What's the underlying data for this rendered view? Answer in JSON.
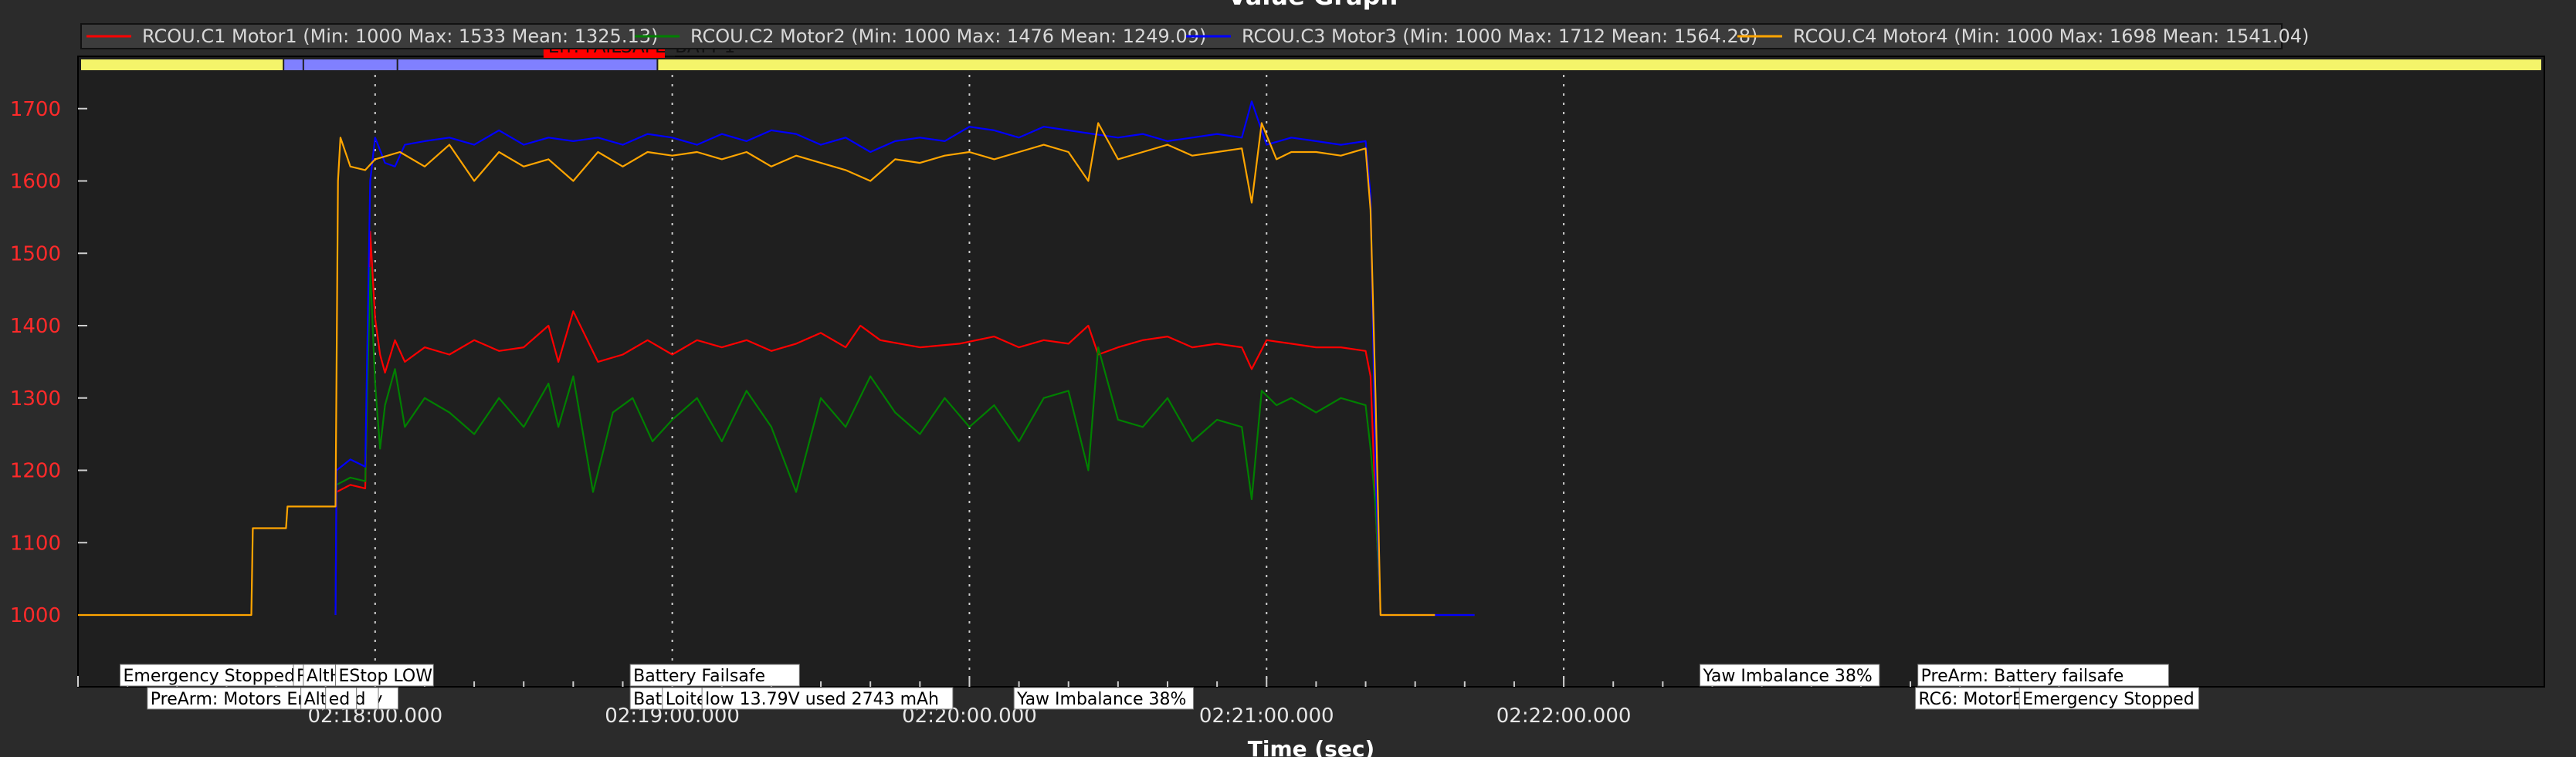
{
  "window": {
    "title": "Value Graph"
  },
  "legend": [
    {
      "label": "RCOU.C1 Motor1 (Min: 1000 Max: 1533 Mean: 1325.13)",
      "color": "#ff0000"
    },
    {
      "label": "RCOU.C2 Motor2 (Min: 1000 Max: 1476 Mean: 1249.09)",
      "color": "#008000"
    },
    {
      "label": "RCOU.C3 Motor3 (Min: 1000 Max: 1712 Mean: 1564.28)",
      "color": "#0000ff"
    },
    {
      "label": "RCOU.C4 Motor4 (Min: 1000 Max: 1698 Mean: 1541.04)",
      "color": "#ffa500"
    }
  ],
  "mode_bar": {
    "error_label": "Err: FAILSAFE_BATT-1"
  },
  "events_row1": [
    {
      "text": "Emergency Stopped",
      "t": 8.5
    },
    {
      "text": "RC",
      "t": 43.5
    },
    {
      "text": "AltHold",
      "t": 45.5
    },
    {
      "text": "EStop LOW",
      "t": 52
    },
    {
      "text": "Battery Failsafe",
      "t": 111.5
    },
    {
      "text": "Yaw Imbalance 38%",
      "t": 327.5
    },
    {
      "text": "PreArm: Battery failsafe",
      "t": 371.5
    }
  ],
  "events_row2": [
    {
      "text": "PreArm: Motors Emergency",
      "t": 14
    },
    {
      "text": "AltHold",
      "t": 45
    },
    {
      "text": "ed",
      "t": 50
    },
    {
      "text": "Batte",
      "t": 111.5
    },
    {
      "text": "Loiter",
      "t": 118
    },
    {
      "text": "low 13.79V used 2743 mAh",
      "t": 126
    },
    {
      "text": "Yaw Imbalance 38%",
      "t": 189
    },
    {
      "text": "RC6: MotorEStop HIGH",
      "t": 371
    },
    {
      "text": "Emergency Stopped",
      "t": 392
    }
  ],
  "chart_data": {
    "type": "line",
    "xlabel": "Time (sec)",
    "ylabel": "",
    "x_unit": "clock time",
    "xlim_seconds_from_02_17_00": [
      0,
      400
    ],
    "ylim": [
      940,
      1740
    ],
    "yticks": [
      1000,
      1100,
      1200,
      1300,
      1400,
      1500,
      1600,
      1700
    ],
    "xticks": [
      {
        "t": 60,
        "label": "02:18:00.000"
      },
      {
        "t": 120,
        "label": "02:19:00.000"
      },
      {
        "t": 180,
        "label": "02:20:00.000"
      },
      {
        "t": 240,
        "label": "02:21:00.000"
      },
      {
        "t": 300,
        "label": "02:22:00.000"
      }
    ],
    "grid": true,
    "series": [
      {
        "name": "RCOU.C1 Motor1",
        "color": "#ff0000",
        "points": [
          [
            52,
            1000
          ],
          [
            52.2,
            1170
          ],
          [
            55,
            1180
          ],
          [
            58,
            1175
          ],
          [
            59,
            1530
          ],
          [
            60,
            1410
          ],
          [
            61,
            1360
          ],
          [
            62,
            1335
          ],
          [
            64,
            1380
          ],
          [
            66,
            1350
          ],
          [
            70,
            1370
          ],
          [
            75,
            1360
          ],
          [
            80,
            1380
          ],
          [
            85,
            1365
          ],
          [
            90,
            1370
          ],
          [
            95,
            1400
          ],
          [
            97,
            1350
          ],
          [
            100,
            1420
          ],
          [
            105,
            1350
          ],
          [
            110,
            1360
          ],
          [
            115,
            1380
          ],
          [
            120,
            1360
          ],
          [
            125,
            1380
          ],
          [
            130,
            1370
          ],
          [
            135,
            1380
          ],
          [
            140,
            1365
          ],
          [
            145,
            1375
          ],
          [
            150,
            1390
          ],
          [
            155,
            1370
          ],
          [
            158,
            1400
          ],
          [
            162,
            1380
          ],
          [
            170,
            1370
          ],
          [
            178,
            1375
          ],
          [
            185,
            1385
          ],
          [
            190,
            1370
          ],
          [
            195,
            1380
          ],
          [
            200,
            1375
          ],
          [
            204,
            1400
          ],
          [
            206,
            1360
          ],
          [
            210,
            1370
          ],
          [
            215,
            1380
          ],
          [
            220,
            1385
          ],
          [
            225,
            1370
          ],
          [
            230,
            1375
          ],
          [
            235,
            1370
          ],
          [
            237,
            1340
          ],
          [
            240,
            1380
          ],
          [
            245,
            1375
          ],
          [
            250,
            1370
          ],
          [
            255,
            1370
          ],
          [
            260,
            1365
          ],
          [
            261,
            1330
          ],
          [
            262,
            1150
          ],
          [
            263,
            1000
          ],
          [
            282,
            1000
          ]
        ]
      },
      {
        "name": "RCOU.C2 Motor2",
        "color": "#008000",
        "points": [
          [
            52,
            1000
          ],
          [
            52.2,
            1180
          ],
          [
            55,
            1190
          ],
          [
            58,
            1185
          ],
          [
            59,
            1480
          ],
          [
            60,
            1320
          ],
          [
            61,
            1230
          ],
          [
            62,
            1290
          ],
          [
            64,
            1340
          ],
          [
            66,
            1260
          ],
          [
            70,
            1300
          ],
          [
            75,
            1280
          ],
          [
            80,
            1250
          ],
          [
            85,
            1300
          ],
          [
            90,
            1260
          ],
          [
            95,
            1320
          ],
          [
            97,
            1260
          ],
          [
            100,
            1330
          ],
          [
            104,
            1170
          ],
          [
            108,
            1280
          ],
          [
            112,
            1300
          ],
          [
            116,
            1240
          ],
          [
            120,
            1270
          ],
          [
            125,
            1300
          ],
          [
            130,
            1240
          ],
          [
            135,
            1310
          ],
          [
            140,
            1260
          ],
          [
            145,
            1170
          ],
          [
            150,
            1300
          ],
          [
            155,
            1260
          ],
          [
            160,
            1330
          ],
          [
            165,
            1280
          ],
          [
            170,
            1250
          ],
          [
            175,
            1300
          ],
          [
            180,
            1260
          ],
          [
            185,
            1290
          ],
          [
            190,
            1240
          ],
          [
            195,
            1300
          ],
          [
            200,
            1310
          ],
          [
            204,
            1200
          ],
          [
            206,
            1370
          ],
          [
            210,
            1270
          ],
          [
            215,
            1260
          ],
          [
            220,
            1300
          ],
          [
            225,
            1240
          ],
          [
            230,
            1270
          ],
          [
            235,
            1260
          ],
          [
            237,
            1160
          ],
          [
            239,
            1310
          ],
          [
            242,
            1290
          ],
          [
            245,
            1300
          ],
          [
            250,
            1280
          ],
          [
            255,
            1300
          ],
          [
            260,
            1290
          ],
          [
            261,
            1230
          ],
          [
            262,
            1150
          ],
          [
            263,
            1000
          ],
          [
            282,
            1000
          ]
        ]
      },
      {
        "name": "RCOU.C3 Motor3",
        "color": "#0000ff",
        "points": [
          [
            52,
            1000
          ],
          [
            52.2,
            1200
          ],
          [
            55,
            1215
          ],
          [
            58,
            1205
          ],
          [
            59,
            1600
          ],
          [
            60,
            1660
          ],
          [
            62,
            1625
          ],
          [
            64,
            1620
          ],
          [
            66,
            1650
          ],
          [
            70,
            1655
          ],
          [
            75,
            1660
          ],
          [
            80,
            1650
          ],
          [
            85,
            1670
          ],
          [
            90,
            1650
          ],
          [
            95,
            1660
          ],
          [
            100,
            1655
          ],
          [
            105,
            1660
          ],
          [
            110,
            1650
          ],
          [
            115,
            1665
          ],
          [
            120,
            1660
          ],
          [
            125,
            1650
          ],
          [
            130,
            1665
          ],
          [
            135,
            1655
          ],
          [
            140,
            1670
          ],
          [
            145,
            1665
          ],
          [
            150,
            1650
          ],
          [
            155,
            1660
          ],
          [
            160,
            1640
          ],
          [
            165,
            1655
          ],
          [
            170,
            1660
          ],
          [
            175,
            1655
          ],
          [
            180,
            1675
          ],
          [
            185,
            1670
          ],
          [
            190,
            1660
          ],
          [
            195,
            1675
          ],
          [
            200,
            1670
          ],
          [
            205,
            1665
          ],
          [
            210,
            1660
          ],
          [
            215,
            1665
          ],
          [
            220,
            1655
          ],
          [
            225,
            1660
          ],
          [
            230,
            1665
          ],
          [
            235,
            1660
          ],
          [
            237,
            1710
          ],
          [
            240,
            1650
          ],
          [
            245,
            1660
          ],
          [
            250,
            1655
          ],
          [
            255,
            1650
          ],
          [
            260,
            1655
          ],
          [
            261,
            1580
          ],
          [
            262,
            1200
          ],
          [
            263,
            1000
          ],
          [
            282,
            1000
          ]
        ]
      },
      {
        "name": "RCOU.C4 Motor4",
        "color": "#ffa500",
        "points": [
          [
            0,
            1000
          ],
          [
            35,
            1000
          ],
          [
            35.3,
            1120
          ],
          [
            42,
            1120
          ],
          [
            42.3,
            1150
          ],
          [
            49,
            1150
          ],
          [
            49.3,
            1150
          ],
          [
            52,
            1150
          ],
          [
            52.5,
            1600
          ],
          [
            53,
            1660
          ],
          [
            55,
            1620
          ],
          [
            58,
            1615
          ],
          [
            60,
            1630
          ],
          [
            65,
            1640
          ],
          [
            70,
            1620
          ],
          [
            75,
            1650
          ],
          [
            80,
            1600
          ],
          [
            85,
            1640
          ],
          [
            90,
            1620
          ],
          [
            95,
            1630
          ],
          [
            100,
            1600
          ],
          [
            105,
            1640
          ],
          [
            110,
            1620
          ],
          [
            115,
            1640
          ],
          [
            120,
            1635
          ],
          [
            125,
            1640
          ],
          [
            130,
            1630
          ],
          [
            135,
            1640
          ],
          [
            140,
            1620
          ],
          [
            145,
            1635
          ],
          [
            150,
            1625
          ],
          [
            155,
            1615
          ],
          [
            160,
            1600
          ],
          [
            165,
            1630
          ],
          [
            170,
            1625
          ],
          [
            175,
            1635
          ],
          [
            180,
            1640
          ],
          [
            185,
            1630
          ],
          [
            190,
            1640
          ],
          [
            195,
            1650
          ],
          [
            200,
            1640
          ],
          [
            204,
            1600
          ],
          [
            206,
            1680
          ],
          [
            210,
            1630
          ],
          [
            215,
            1640
          ],
          [
            220,
            1650
          ],
          [
            225,
            1635
          ],
          [
            230,
            1640
          ],
          [
            235,
            1645
          ],
          [
            237,
            1570
          ],
          [
            239,
            1680
          ],
          [
            242,
            1630
          ],
          [
            245,
            1640
          ],
          [
            250,
            1640
          ],
          [
            255,
            1635
          ],
          [
            260,
            1645
          ],
          [
            261,
            1560
          ],
          [
            262,
            1300
          ],
          [
            263,
            1000
          ],
          [
            274,
            1000
          ]
        ]
      }
    ]
  }
}
